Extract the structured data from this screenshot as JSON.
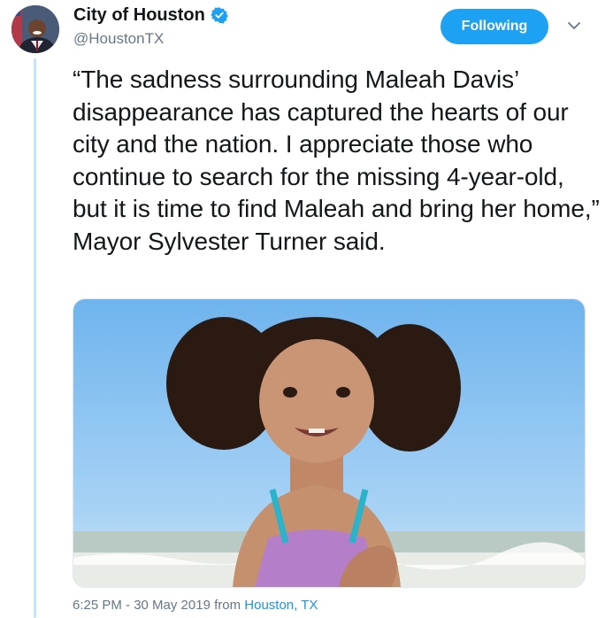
{
  "account": {
    "display_name": "City of Houston",
    "handle": "@HoustonTX",
    "verified": true,
    "avatar_icon": "avatar-photo"
  },
  "actions": {
    "follow_label": "Following",
    "more_icon": "chevron-down-icon"
  },
  "tweet": {
    "text": "“The sadness surrounding Maleah Davis’ disappearance has captured the hearts of our city and the nation. I appreciate those who continue to search for the missing 4-year-old, but it is time to find Maleah and bring her home,” Mayor Sylvester Turner said."
  },
  "meta": {
    "timestamp": "6:25 PM - 30 May 2019",
    "from_word": "from",
    "location": "Houston, TX"
  },
  "colors": {
    "accent": "#1da1f2",
    "link": "#1b95e0",
    "muted": "#657786",
    "thread_line": "#c4e3f6"
  }
}
